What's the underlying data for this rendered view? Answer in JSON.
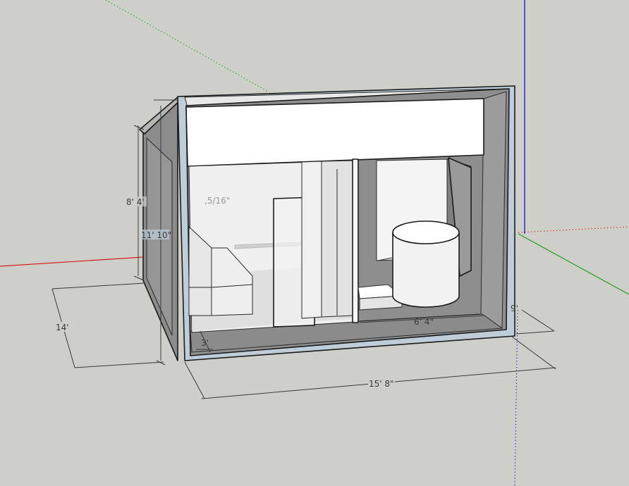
{
  "scene": {
    "colors": {
      "background": "#cfcfca",
      "axis_red": "#d02020",
      "axis_green": "#20a020",
      "axis_blue": "#2020d0",
      "wall_face": "#bfcdd8",
      "interior_gray": "#8e8e8e",
      "white_panel": "#ffffff"
    }
  },
  "dimensions": {
    "height_outer": "11' 10\"",
    "height_inner": "8' 4'",
    "depth": "14'",
    "width": "15' 8\"",
    "inner_width": "6' 4\"",
    "small_offset": "3'",
    "fraction_label": ",5/16\"",
    "right_short": "9'"
  }
}
